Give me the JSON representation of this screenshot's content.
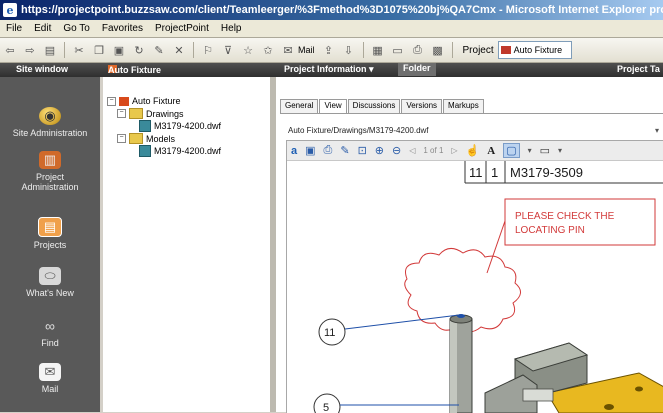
{
  "window": {
    "title": "https://projectpoint.buzzsaw.com/client/Teamleerger/%3Fmethod%3D1075%20bj%QA7Cmx - Microsoft Internet Explorer pro"
  },
  "menu": [
    "File",
    "Edit",
    "Go To",
    "Favorites",
    "ProjectPoint",
    "Help"
  ],
  "toolbar": {
    "mail_label": "Mail",
    "project_label": "Project",
    "project_value": "Auto Fixture"
  },
  "header": {
    "site_window": "Site window",
    "auto_fixture": "Auto Fixture",
    "project_information": "Project Information ▾",
    "folder": "Folder",
    "project_tasks": "Project Ta"
  },
  "sidebar": {
    "items": [
      {
        "label": "Site Administration",
        "icon": "admin-globe-icon"
      },
      {
        "label": "Project Administration",
        "icon": "project-admin-icon"
      },
      {
        "label": "Projects",
        "icon": "projects-icon"
      },
      {
        "label": "What's New",
        "icon": "whats-new-icon"
      },
      {
        "label": "Find",
        "icon": "binoculars-icon"
      },
      {
        "label": "Mail",
        "icon": "mail-icon"
      }
    ]
  },
  "tree": {
    "root": "Auto Fixture",
    "drawings": "Drawings",
    "drawing_file": "M3179-4200.dwf",
    "models": "Models",
    "model_file": "M3179-4200.dwf"
  },
  "tabs": [
    "General",
    "View",
    "Discussions",
    "Versions",
    "Markups"
  ],
  "path": "Auto Fixture/Drawings/M3179-4200.dwf",
  "viewer": {
    "page_indicator": "1 of 1",
    "text_tool": "A"
  },
  "drawing": {
    "table_qty": "11",
    "table_item": "1",
    "table_part": "M3179-3509",
    "markup_text_1": "PLEASE CHECK THE",
    "markup_text_2": "LOCATING PIN",
    "balloon_1": "11",
    "balloon_2": "5"
  },
  "colors": {
    "markup": "#d23a3a",
    "sidebar_bg": "#595959",
    "fixture_yellow": "#e8b820"
  }
}
